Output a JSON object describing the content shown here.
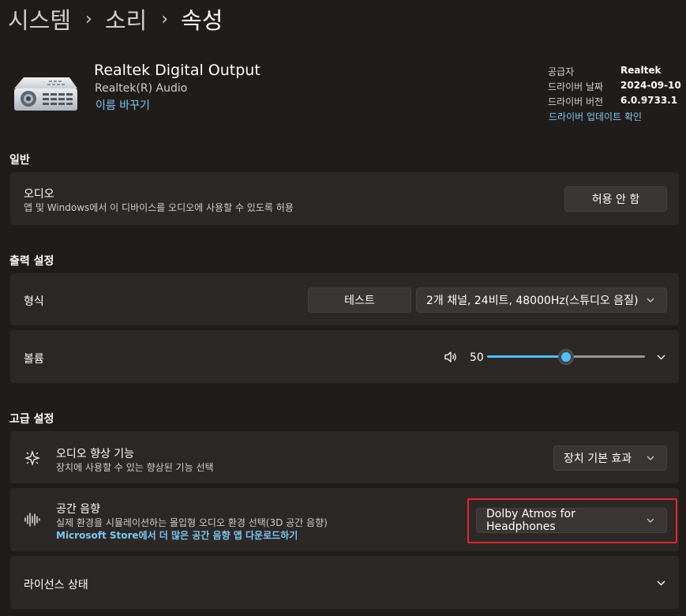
{
  "breadcrumb": {
    "items": [
      "시스템",
      "소리",
      "속성"
    ],
    "separator": "›"
  },
  "device": {
    "name": "Realtek Digital Output",
    "driver_name": "Realtek(R) Audio",
    "rename_link": "이름 바꾸기",
    "icon": "speaker-device-icon"
  },
  "driver_info": {
    "provider_label": "공급자",
    "provider_value": "Realtek",
    "date_label": "드라이버 날짜",
    "date_value": "2024-09-10",
    "version_label": "드라이버 버전",
    "version_value": "6.0.9733.1",
    "update_link": "드라이버 업데이트 확인"
  },
  "general": {
    "heading": "일반",
    "audio": {
      "title": "오디오",
      "description": "앱 및 Windows에서 이 디바이스를 오디오에 사용할 수 있도록 허용",
      "button": "허용 안 함"
    }
  },
  "output_settings": {
    "heading": "출력 설정",
    "format": {
      "title": "형식",
      "test_button": "테스트",
      "selected": "2개 채널, 24비트, 48000Hz(스튜디오 음질)"
    },
    "volume": {
      "title": "볼륨",
      "value": "50",
      "level": 0.5,
      "icon": "speaker-volume-icon"
    }
  },
  "advanced": {
    "heading": "고급 설정",
    "enhancements": {
      "title": "오디오 향상 기능",
      "description": "장치에 사용할 수 있는 향상된 기능 선택",
      "selected": "장치 기본 효과",
      "icon": "sparkle-enhance-icon"
    },
    "spatial": {
      "title": "공간 음향",
      "description": "실제 환경을 시뮬레이션하는 몰입형 오디오 환경 선택(3D 공간 음향)",
      "store_link": "Microsoft Store에서 더 많은 공간 음향 앱 다운로드하기",
      "selected": "Dolby Atmos for Headphones",
      "icon": "soundwave-icon"
    },
    "license": {
      "title": "라이선스 상태"
    }
  },
  "colors": {
    "accent": "#4cc2ff",
    "link": "#7cc7f2",
    "highlight": "#e3262c",
    "background": "#201c1a",
    "card": "#2b2826"
  }
}
